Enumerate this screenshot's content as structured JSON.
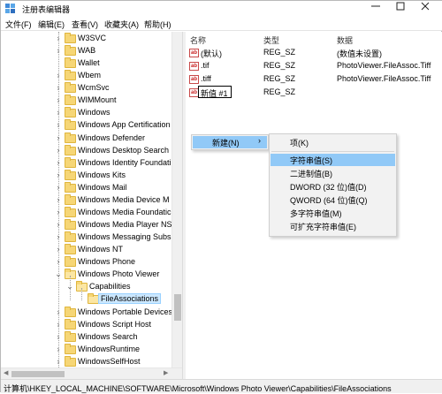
{
  "window": {
    "title": "注册表编辑器"
  },
  "menu": [
    "文件(F)",
    "编辑(E)",
    "查看(V)",
    "收藏夹(A)",
    "帮助(H)"
  ],
  "tree": {
    "items": [
      {
        "label": "W3SVC",
        "state": "collapsed"
      },
      {
        "label": "WAB",
        "state": "collapsed"
      },
      {
        "label": "Wallet",
        "state": "none"
      },
      {
        "label": "Wbem",
        "state": "collapsed"
      },
      {
        "label": "WcmSvc",
        "state": "collapsed"
      },
      {
        "label": "WIMMount",
        "state": "collapsed"
      },
      {
        "label": "Windows",
        "state": "collapsed"
      },
      {
        "label": "Windows App Certification",
        "state": "collapsed"
      },
      {
        "label": "Windows Defender",
        "state": "collapsed"
      },
      {
        "label": "Windows Desktop Search",
        "state": "collapsed"
      },
      {
        "label": "Windows Identity Foundati",
        "state": "collapsed"
      },
      {
        "label": "Windows Kits",
        "state": "collapsed"
      },
      {
        "label": "Windows Mail",
        "state": "collapsed"
      },
      {
        "label": "Windows Media Device M",
        "state": "collapsed"
      },
      {
        "label": "Windows Media Foundatic",
        "state": "collapsed"
      },
      {
        "label": "Windows Media Player NS",
        "state": "collapsed"
      },
      {
        "label": "Windows Messaging Subs",
        "state": "collapsed"
      },
      {
        "label": "Windows NT",
        "state": "collapsed"
      },
      {
        "label": "Windows Phone",
        "state": "collapsed"
      },
      {
        "label": "Windows Photo Viewer",
        "state": "expanded"
      },
      {
        "label": "Capabilities",
        "state": "expanded",
        "level": 1
      },
      {
        "label": "FileAssociations",
        "state": "none",
        "level": 2,
        "selected": true
      },
      {
        "label": "Windows Portable Devices",
        "state": "collapsed"
      },
      {
        "label": "Windows Script Host",
        "state": "collapsed"
      },
      {
        "label": "Windows Search",
        "state": "collapsed"
      },
      {
        "label": "WindowsRuntime",
        "state": "collapsed"
      },
      {
        "label": "WindowsSelfHost",
        "state": "collapsed"
      }
    ]
  },
  "list": {
    "columns": [
      "名称",
      "类型",
      "数据"
    ],
    "rows": [
      {
        "name": "(默认)",
        "type": "REG_SZ",
        "data": "(数值未设置)"
      },
      {
        "name": ".tif",
        "type": "REG_SZ",
        "data": "PhotoViewer.FileAssoc.Tiff"
      },
      {
        "name": ".tiff",
        "type": "REG_SZ",
        "data": "PhotoViewer.FileAssoc.Tiff"
      },
      {
        "name": "新值 #1",
        "type": "REG_SZ",
        "data": ""
      }
    ]
  },
  "context_menu": {
    "label": "新建(N)",
    "arrow": "›"
  },
  "submenu": {
    "items": [
      "项(K)",
      "字符串值(S)",
      "二进制值(B)",
      "DWORD (32 位)值(D)",
      "QWORD (64 位)值(Q)",
      "多字符串值(M)",
      "可扩充字符串值(E)"
    ],
    "highlighted": 1
  },
  "status": "计算机\\HKEY_LOCAL_MACHINE\\SOFTWARE\\Microsoft\\Windows Photo Viewer\\Capabilities\\FileAssociations",
  "icons": {
    "value": "ab-string-icon",
    "folder": "folder-icon"
  },
  "colors": {
    "selection": "#91c9f7",
    "folder": "#f6d676"
  }
}
